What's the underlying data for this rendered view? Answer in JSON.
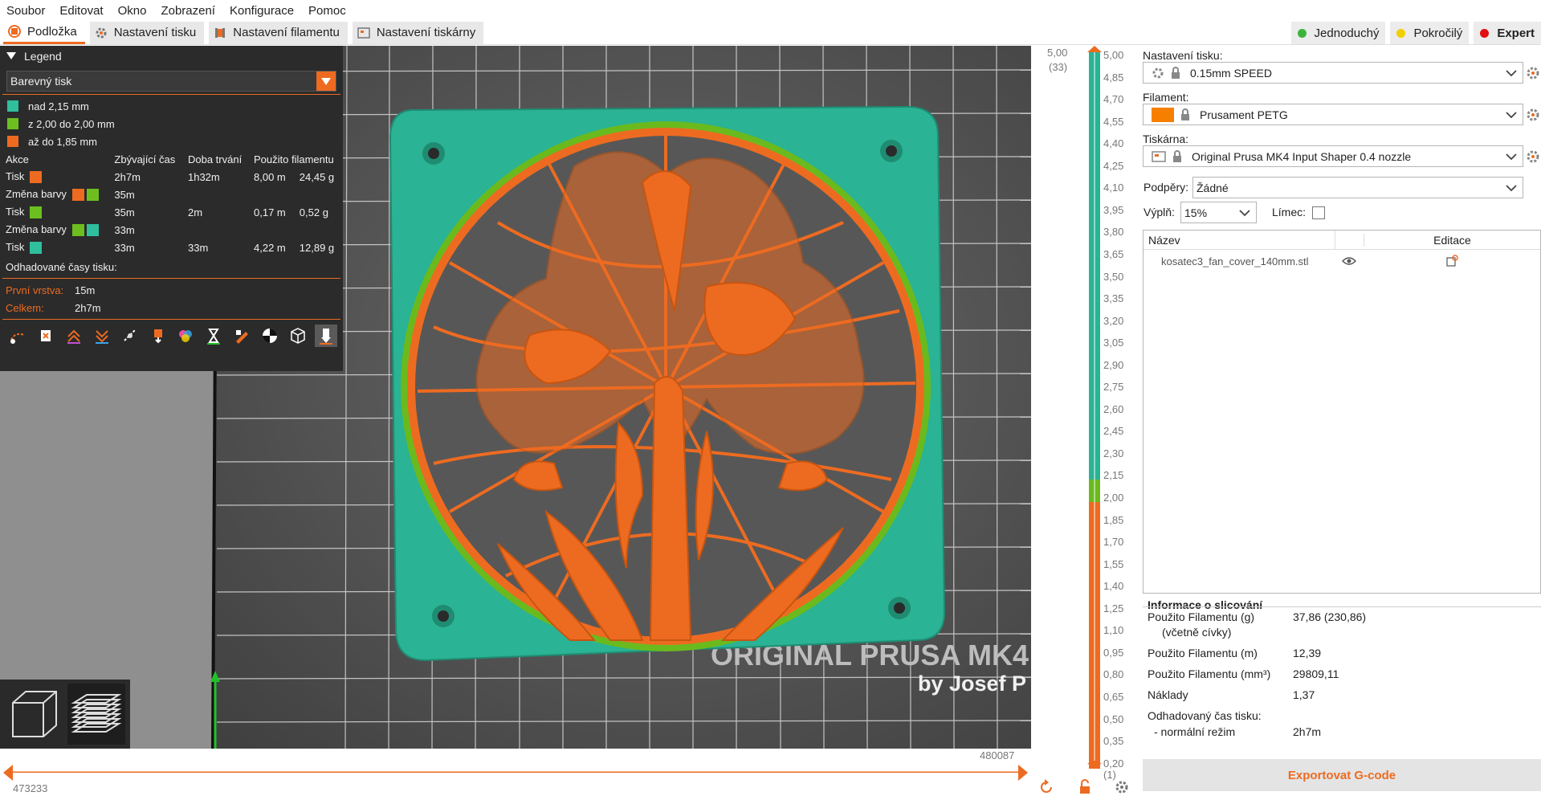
{
  "menu": [
    "Soubor",
    "Editovat",
    "Okno",
    "Zobrazení",
    "Konfigurace",
    "Pomoc"
  ],
  "tabs": [
    {
      "label": "Podložka",
      "icon": "plater-icon",
      "active": true
    },
    {
      "label": "Nastavení tisku",
      "icon": "print-settings-gear-icon",
      "active": false
    },
    {
      "label": "Nastavení filamentu",
      "icon": "filament-spool-icon",
      "active": false
    },
    {
      "label": "Nastavení tiskárny",
      "icon": "printer-icon",
      "active": false
    }
  ],
  "modes": [
    {
      "label": "Jednoduchý",
      "color": "#3cb43c"
    },
    {
      "label": "Pokročilý",
      "color": "#f0d000"
    },
    {
      "label": "Expert",
      "color": "#e01010",
      "active": true
    }
  ],
  "legend": {
    "title": "Legend",
    "view_type": "Barevný tisk",
    "ranges": [
      {
        "label": "nad 2,15 mm",
        "color": "#2fbf9c"
      },
      {
        "label": "z 2,00 do 2,00 mm",
        "color": "#6cbf1f"
      },
      {
        "label": "až do 1,85 mm",
        "color": "#ed6b21"
      }
    ],
    "headers": [
      "Akce",
      "Zbývající čas",
      "Doba trvání",
      "Použito filamentu"
    ],
    "rows": [
      {
        "action": "Tisk",
        "colors": [
          "#ed6b21"
        ],
        "remaining": "2h7m",
        "duration": "1h32m",
        "length": "8,00 m",
        "weight": "24,45 g"
      },
      {
        "action": "Změna barvy",
        "colors": [
          "#ed6b21",
          "#6cbf1f"
        ],
        "remaining": "35m",
        "duration": "",
        "length": "",
        "weight": ""
      },
      {
        "action": "Tisk",
        "colors": [
          "#6cbf1f"
        ],
        "remaining": "35m",
        "duration": "2m",
        "length": "0,17 m",
        "weight": "0,52 g"
      },
      {
        "action": "Změna barvy",
        "colors": [
          "#6cbf1f",
          "#2fbf9c"
        ],
        "remaining": "33m",
        "duration": "",
        "length": "",
        "weight": ""
      },
      {
        "action": "Tisk",
        "colors": [
          "#2fbf9c"
        ],
        "remaining": "33m",
        "duration": "33m",
        "length": "4,22 m",
        "weight": "12,89 g"
      }
    ],
    "times_title": "Odhadované časy tisku:",
    "first_layer_label": "První vrstva:",
    "first_layer_value": "15m",
    "total_label": "Celkem:",
    "total_value": "2h7m",
    "tools": [
      "travel-icon",
      "wipe-icon",
      "retractions-icon",
      "deretractions-icon",
      "seams-icon",
      "tool-changes-icon",
      "color-changes-icon",
      "pause-prints-icon",
      "custom-gcodes-icon",
      "center-of-gravity-icon",
      "shells-icon",
      "tool-marker-icon"
    ]
  },
  "vertical_slider": {
    "top_value": "5,00",
    "top_layer": "(33)",
    "bottom_value": "0,20",
    "bottom_layer": "(1)",
    "ticks": [
      "5,00",
      "4,85",
      "4,70",
      "4,55",
      "4,40",
      "4,25",
      "4,10",
      "3,95",
      "3,80",
      "3,65",
      "3,50",
      "3,35",
      "3,20",
      "3,05",
      "2,90",
      "2,75",
      "2,60",
      "2,45",
      "2,30",
      "2,15",
      "2,00",
      "1,85",
      "1,70",
      "1,55",
      "1,40",
      "1,25",
      "1,10",
      "0,95",
      "0,80",
      "0,65",
      "0,50",
      "0,35",
      "0,20"
    ]
  },
  "horizontal_slider": {
    "left_value": "473233",
    "right_value": "480087"
  },
  "bed_text": {
    "line1": "ORIGINAL PRUSA MK4",
    "line2": "by Josef P"
  },
  "right_panel": {
    "print_label": "Nastavení tisku:",
    "print_value": "0.15mm SPEED",
    "filament_label": "Filament:",
    "filament_value": "Prusament PETG",
    "filament_color": "#f77f00",
    "printer_label": "Tiskárna:",
    "printer_value": "Original Prusa MK4 Input Shaper 0.4 nozzle",
    "supports_label": "Podpěry:",
    "supports_value": "Žádné",
    "infill_label": "Výplň:",
    "infill_value": "15%",
    "brim_label": "Límec:",
    "col_name": "Název",
    "col_edit": "Editace",
    "objects": [
      {
        "name": "kosatec3_fan_cover_140mm.stl"
      }
    ],
    "info_title": "Informace o slicování",
    "info": [
      {
        "label": "Použito Filamentu (g)",
        "value": "37,86 (230,86)"
      },
      {
        "label": "(včetně cívky)",
        "value": ""
      },
      {
        "label": "Použito Filamentu (m)",
        "value": "12,39"
      },
      {
        "label": "Použito Filamentu (mm³)",
        "value": "29809,11"
      },
      {
        "label": "Náklady",
        "value": "1,37"
      },
      {
        "label": "Odhadovaný čas tisku:",
        "value": ""
      },
      {
        "label": "- normální režim",
        "value": "2h7m"
      }
    ],
    "export_label": "Exportovat G-code"
  }
}
